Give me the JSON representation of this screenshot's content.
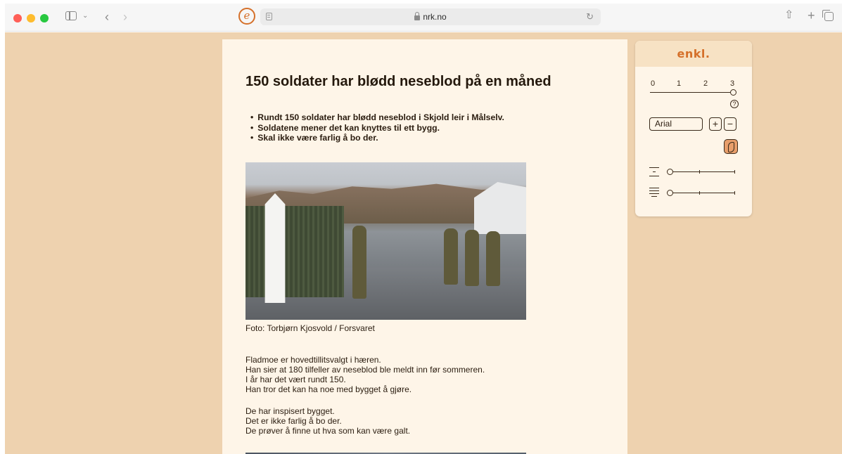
{
  "browser": {
    "url": "nrk.no"
  },
  "icons": {
    "sidebar": "sidebar-icon",
    "back": "chevron-left-icon",
    "forward": "chevron-right-icon",
    "reader": "reader-icon",
    "lock": "lock-icon",
    "reload": "reload-icon",
    "share": "share-icon",
    "new_tab": "plus-icon",
    "tabs": "tab-overview-icon",
    "extension": "enkl-extension-icon"
  },
  "glyphs": {
    "chev_down": "⌄",
    "back": "‹",
    "forward": "›",
    "reload": "↻",
    "share": "⇧",
    "plus": "+",
    "extension": "e",
    "help": "?",
    "plus_sign": "+",
    "minus_sign": "−"
  },
  "article": {
    "title": "150 soldater har blødd neseblod på en måned",
    "bullets": [
      "Rundt 150 soldater har blødd neseblod i Skjold leir i Målselv.",
      "Soldatene mener det kan knyttes til ett bygg.",
      "Skal ikke være farlig å bo der."
    ],
    "photo_caption": "Foto: Torbjørn Kjosvold / Forsvaret",
    "paragraph1": [
      "Fladmoe er hovedtillitsvalgt i hæren.",
      "Han sier at 180 tilfeller av neseblod ble meldt inn før sommeren.",
      "I år har det vært rundt 150.",
      "Han tror det kan ha noe med bygget å gjøre."
    ],
    "paragraph2": [
      "De har inspisert bygget.",
      "Det er ikke farlig å bo der.",
      "De prøver å finne ut hva som kan være galt."
    ]
  },
  "panel": {
    "logo": "enkl.",
    "levels": [
      "0",
      "1",
      "2",
      "3"
    ],
    "selected_level": 3,
    "font": "Arial",
    "line_height_level": 0,
    "word_spacing_level": 0
  },
  "colors": {
    "accent": "#d5702a",
    "background": "#eed2af",
    "page": "#fef5e8",
    "text": "#2b1d10"
  }
}
